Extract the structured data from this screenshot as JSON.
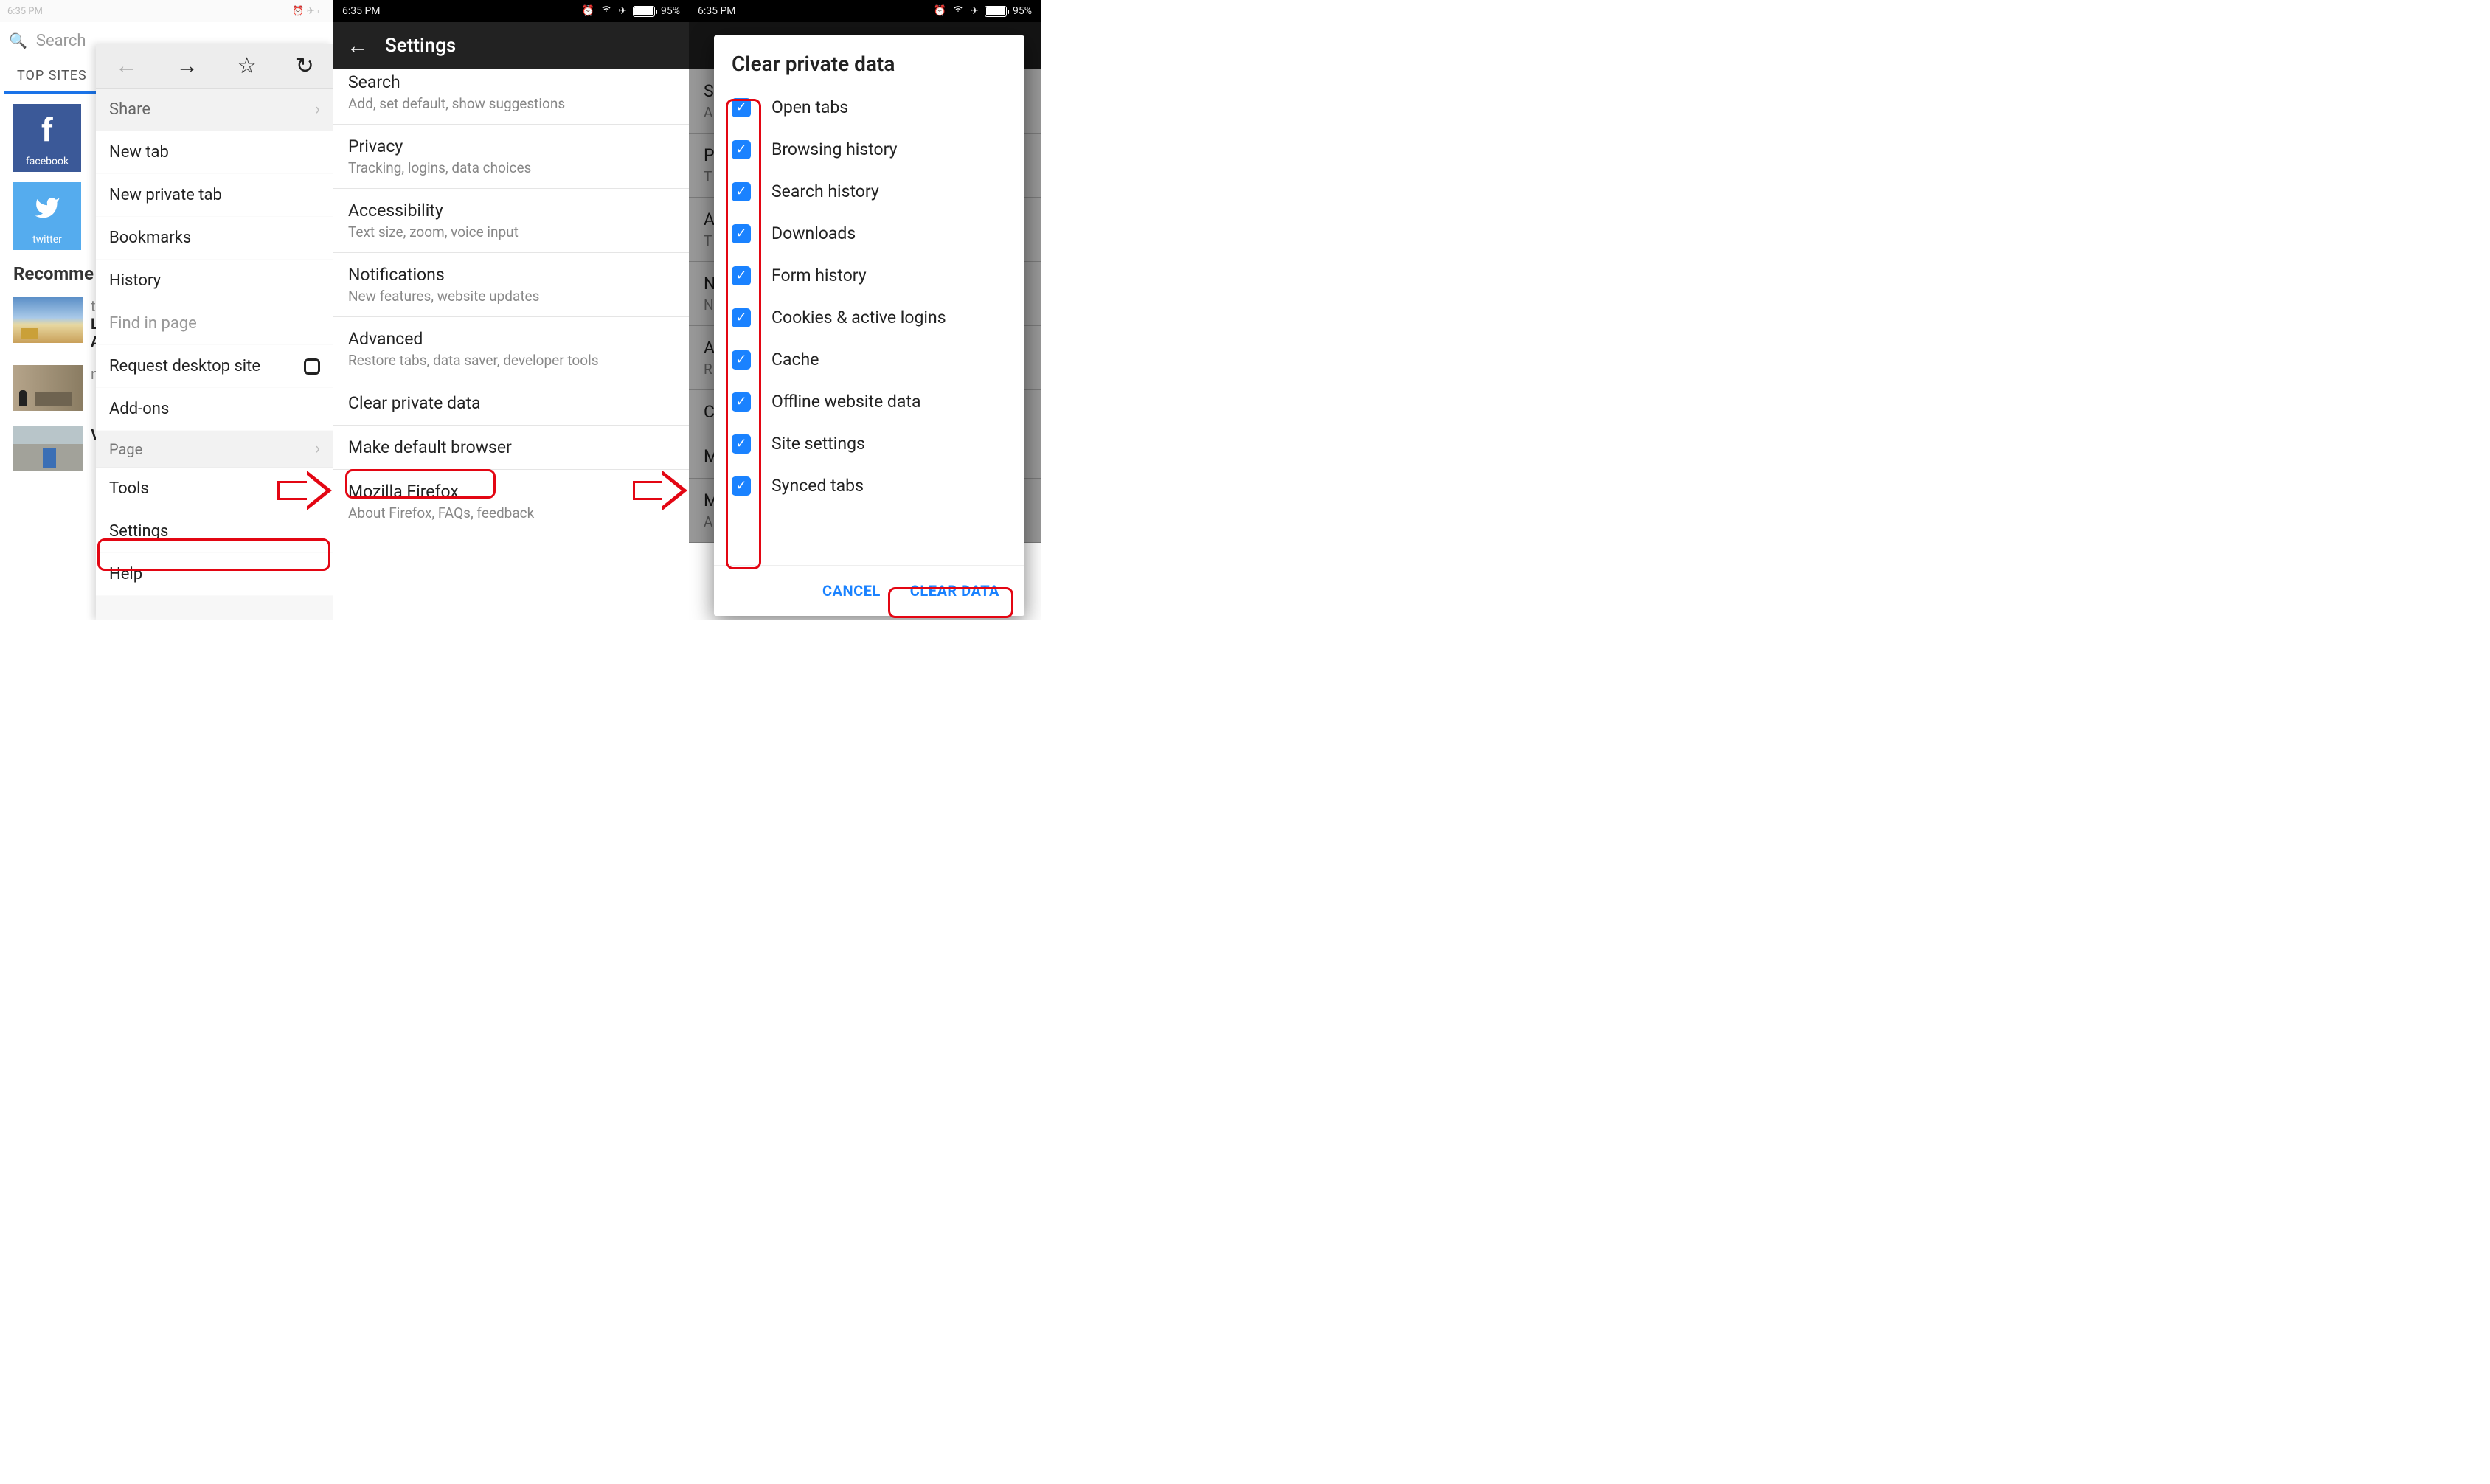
{
  "panel1": {
    "status_time": "6:35 PM",
    "search_placeholder": "Search",
    "tab_label": "TOP SITES",
    "tiles": [
      {
        "label": "facebook",
        "letter": "f"
      },
      {
        "label": "twitter",
        "letter": ""
      }
    ],
    "recommended_label": "Recomme",
    "cards": [
      "t",
      "n",
      ""
    ],
    "menu": {
      "share": "Share",
      "new_tab": "New tab",
      "new_private": "New private tab",
      "bookmarks": "Bookmarks",
      "history": "History",
      "find": "Find in page",
      "request_desktop": "Request desktop site",
      "addons": "Add-ons",
      "page": "Page",
      "tools": "Tools",
      "settings": "Settings",
      "help": "Help"
    }
  },
  "panel2": {
    "status_time": "6:35 PM",
    "battery": "95%",
    "header": "Settings",
    "rows": [
      {
        "title": "Search",
        "sub": "Add, set default, show suggestions"
      },
      {
        "title": "Privacy",
        "sub": "Tracking, logins, data choices"
      },
      {
        "title": "Accessibility",
        "sub": "Text size, zoom, voice input"
      },
      {
        "title": "Notifications",
        "sub": "New features, website updates"
      },
      {
        "title": "Advanced",
        "sub": "Restore tabs, data saver, developer tools"
      },
      {
        "title": "Clear private data",
        "sub": ""
      },
      {
        "title": "Make default browser",
        "sub": ""
      },
      {
        "title": "Mozilla Firefox",
        "sub": "About Firefox, FAQs, feedback"
      }
    ]
  },
  "panel3": {
    "status_time": "6:35 PM",
    "battery": "95%",
    "faded_rows": [
      {
        "t": "S",
        "s": "A"
      },
      {
        "t": "P",
        "s": "T"
      },
      {
        "t": "A",
        "s": "T"
      },
      {
        "t": "N",
        "s": "N"
      },
      {
        "t": "A",
        "s": "R"
      },
      {
        "t": "C",
        "s": ""
      },
      {
        "t": "M",
        "s": ""
      },
      {
        "t": "M",
        "s": "A"
      }
    ],
    "dialog": {
      "title": "Clear private data",
      "items": [
        "Open tabs",
        "Browsing history",
        "Search history",
        "Downloads",
        "Form history",
        "Cookies & active logins",
        "Cache",
        "Offline website data",
        "Site settings",
        "Synced tabs"
      ],
      "cancel": "CANCEL",
      "clear": "CLEAR DATA"
    }
  }
}
